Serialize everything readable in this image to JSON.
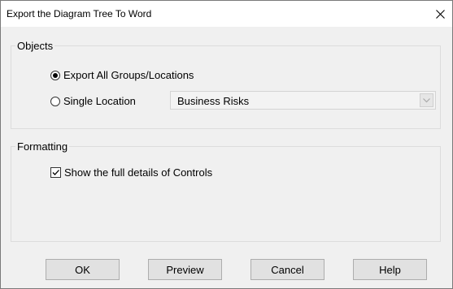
{
  "window": {
    "title": "Export the Diagram Tree To Word",
    "close_icon": "close-icon"
  },
  "objects": {
    "legend": "Objects",
    "export_all_label": "Export All Groups/Locations",
    "export_all_selected": true,
    "single_location_label": "Single Location",
    "single_location_selected": false,
    "location_select": {
      "value": "Business Risks",
      "enabled": false
    }
  },
  "formatting": {
    "legend": "Formatting",
    "full_details_label": "Show the full details of Controls",
    "full_details_checked": true
  },
  "buttons": {
    "ok": "OK",
    "preview": "Preview",
    "cancel": "Cancel",
    "help": "Help"
  },
  "colors": {
    "dialog_bg": "#f0f0f0",
    "button_bg": "#e1e1e1",
    "accent": "#0078d7"
  }
}
